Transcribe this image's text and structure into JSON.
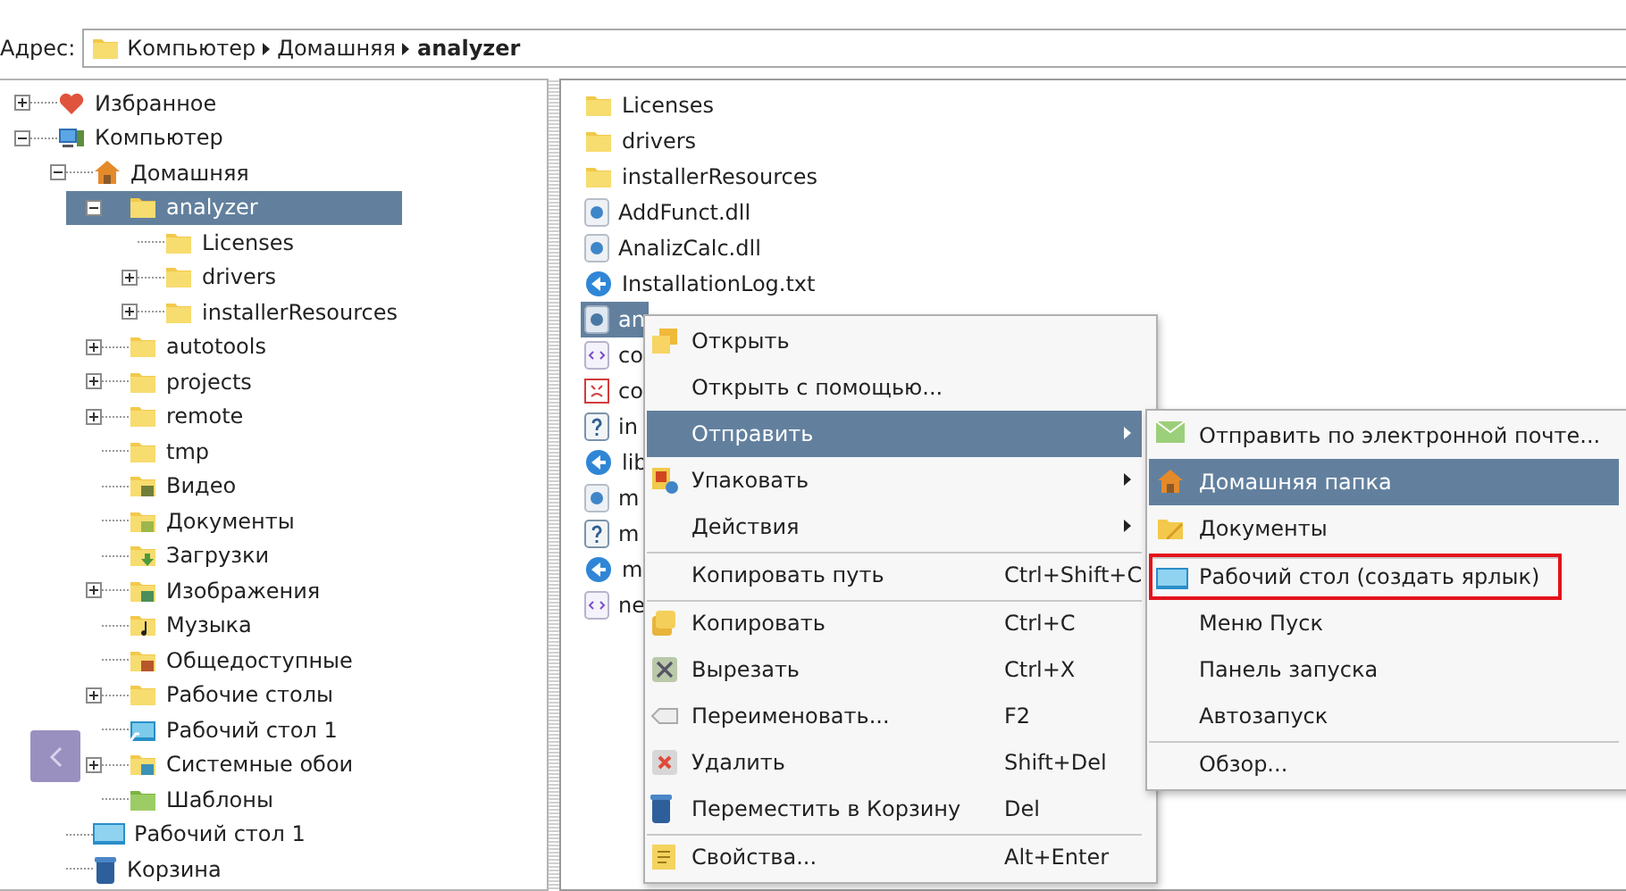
{
  "address": {
    "label": "Адрес:",
    "crumbs": [
      {
        "label": "Компьютер",
        "current": false
      },
      {
        "label": "Домашняя",
        "current": false
      },
      {
        "label": "analyzer",
        "current": true
      }
    ]
  },
  "tree": [
    {
      "label": "Избранное",
      "kind": "favorites",
      "expanded": false,
      "selected": false
    },
    {
      "label": "Компьютер",
      "kind": "computer",
      "expanded": true,
      "selected": false,
      "children": [
        {
          "label": "Домашняя",
          "kind": "home",
          "expanded": true,
          "selected": false,
          "children": [
            {
              "label": "analyzer",
              "kind": "folder",
              "expanded": true,
              "selected": true,
              "children": [
                {
                  "label": "Licenses",
                  "kind": "folder",
                  "selected": false
                },
                {
                  "label": "drivers",
                  "kind": "folder",
                  "expanded": false,
                  "selected": false
                },
                {
                  "label": "installerResources",
                  "kind": "folder",
                  "expanded": false,
                  "selected": false
                }
              ]
            },
            {
              "label": "autotools",
              "kind": "folder",
              "expanded": false,
              "selected": false
            },
            {
              "label": "projects",
              "kind": "folder",
              "expanded": false,
              "selected": false
            },
            {
              "label": "remote",
              "kind": "folder",
              "expanded": false,
              "selected": false
            },
            {
              "label": "tmp",
              "kind": "folder",
              "selected": false
            },
            {
              "label": "Видео",
              "kind": "video",
              "selected": false
            },
            {
              "label": "Документы",
              "kind": "documents",
              "selected": false
            },
            {
              "label": "Загрузки",
              "kind": "downloads",
              "selected": false
            },
            {
              "label": "Изображения",
              "kind": "pictures",
              "expanded": false,
              "selected": false
            },
            {
              "label": "Музыка",
              "kind": "music",
              "selected": false
            },
            {
              "label": "Общедоступные",
              "kind": "public",
              "selected": false
            },
            {
              "label": "Рабочие столы",
              "kind": "folder",
              "expanded": false,
              "selected": false
            },
            {
              "label": "Рабочий стол 1",
              "kind": "desktop_folder",
              "selected": false
            },
            {
              "label": "Системные обои",
              "kind": "wallpaper",
              "expanded": false,
              "selected": false
            },
            {
              "label": "Шаблоны",
              "kind": "templates",
              "selected": false
            }
          ]
        },
        {
          "label": "Рабочий стол 1",
          "kind": "desktop",
          "selected": false
        },
        {
          "label": "Корзина",
          "kind": "trash",
          "selected": false
        }
      ]
    }
  ],
  "files": [
    {
      "name": "Licenses",
      "kind": "folder",
      "selected": false
    },
    {
      "name": "drivers",
      "kind": "folder",
      "selected": false
    },
    {
      "name": "installerResources",
      "kind": "folder",
      "selected": false
    },
    {
      "name": "AddFunct.dll",
      "kind": "library",
      "selected": false
    },
    {
      "name": "AnalizCalc.dll",
      "kind": "library",
      "selected": false
    },
    {
      "name": "InstallationLog.txt",
      "kind": "web",
      "selected": false
    },
    {
      "name": "an",
      "kind": "app",
      "selected": true
    },
    {
      "name": "co",
      "kind": "markup",
      "selected": false
    },
    {
      "name": "co",
      "kind": "broken",
      "selected": false
    },
    {
      "name": "in",
      "kind": "unknown",
      "selected": false
    },
    {
      "name": "lib",
      "kind": "web",
      "selected": false
    },
    {
      "name": "m",
      "kind": "library",
      "selected": false
    },
    {
      "name": "m",
      "kind": "unknown",
      "selected": false
    },
    {
      "name": "m",
      "kind": "web",
      "selected": false
    },
    {
      "name": "ne",
      "kind": "markup",
      "selected": false
    }
  ],
  "context_menu": {
    "items": [
      {
        "label": "Открыть",
        "kind": "open",
        "selected": false,
        "submenu": false,
        "separator_before": false
      },
      {
        "label": "Открыть с помощью...",
        "kind": "none",
        "selected": false,
        "submenu": false,
        "separator_before": false
      },
      {
        "label": "Отправить",
        "kind": "none",
        "selected": true,
        "submenu": true,
        "separator_before": false
      },
      {
        "label": "Упаковать",
        "kind": "pack",
        "selected": false,
        "submenu": true,
        "separator_before": false
      },
      {
        "label": "Действия",
        "kind": "none",
        "selected": false,
        "submenu": true,
        "separator_before": false
      },
      {
        "label": "Копировать путь",
        "kind": "none",
        "shortcut": "Ctrl+Shift+C",
        "selected": false,
        "submenu": false,
        "separator_before": true
      },
      {
        "label": "Копировать",
        "kind": "copy",
        "shortcut": "Ctrl+C",
        "selected": false,
        "submenu": false,
        "separator_before": true
      },
      {
        "label": "Вырезать",
        "kind": "cut",
        "shortcut": "Ctrl+X",
        "selected": false,
        "submenu": false,
        "separator_before": false
      },
      {
        "label": "Переименовать...",
        "kind": "rename",
        "shortcut": "F2",
        "selected": false,
        "submenu": false,
        "separator_before": false
      },
      {
        "label": "Удалить",
        "kind": "delete",
        "shortcut": "Shift+Del",
        "selected": false,
        "submenu": false,
        "separator_before": false
      },
      {
        "label": "Переместить в Корзину",
        "kind": "trash",
        "shortcut": "Del",
        "selected": false,
        "submenu": false,
        "separator_before": false
      },
      {
        "label": "Свойства...",
        "kind": "properties",
        "shortcut": "Alt+Enter",
        "selected": false,
        "submenu": false,
        "separator_before": true
      }
    ]
  },
  "submenu": {
    "items": [
      {
        "label": "Отправить по электронной почте...",
        "kind": "mail",
        "selected": false,
        "outlined": false,
        "separator_before": false
      },
      {
        "label": "Домашняя папка",
        "kind": "home",
        "selected": true,
        "outlined": false,
        "separator_before": false
      },
      {
        "label": "Документы",
        "kind": "documents",
        "selected": false,
        "outlined": false,
        "separator_before": false
      },
      {
        "label": "Рабочий стол (создать ярлык)",
        "kind": "desktop",
        "selected": false,
        "outlined": true,
        "separator_before": true
      },
      {
        "label": "Меню Пуск",
        "kind": "none",
        "selected": false,
        "outlined": false,
        "separator_before": false
      },
      {
        "label": "Панель запуска",
        "kind": "none",
        "selected": false,
        "outlined": false,
        "separator_before": false
      },
      {
        "label": "Автозапуск",
        "kind": "none",
        "selected": false,
        "outlined": false,
        "separator_before": false
      },
      {
        "label": "Обзор...",
        "kind": "none",
        "selected": false,
        "outlined": false,
        "separator_before": true
      }
    ]
  }
}
